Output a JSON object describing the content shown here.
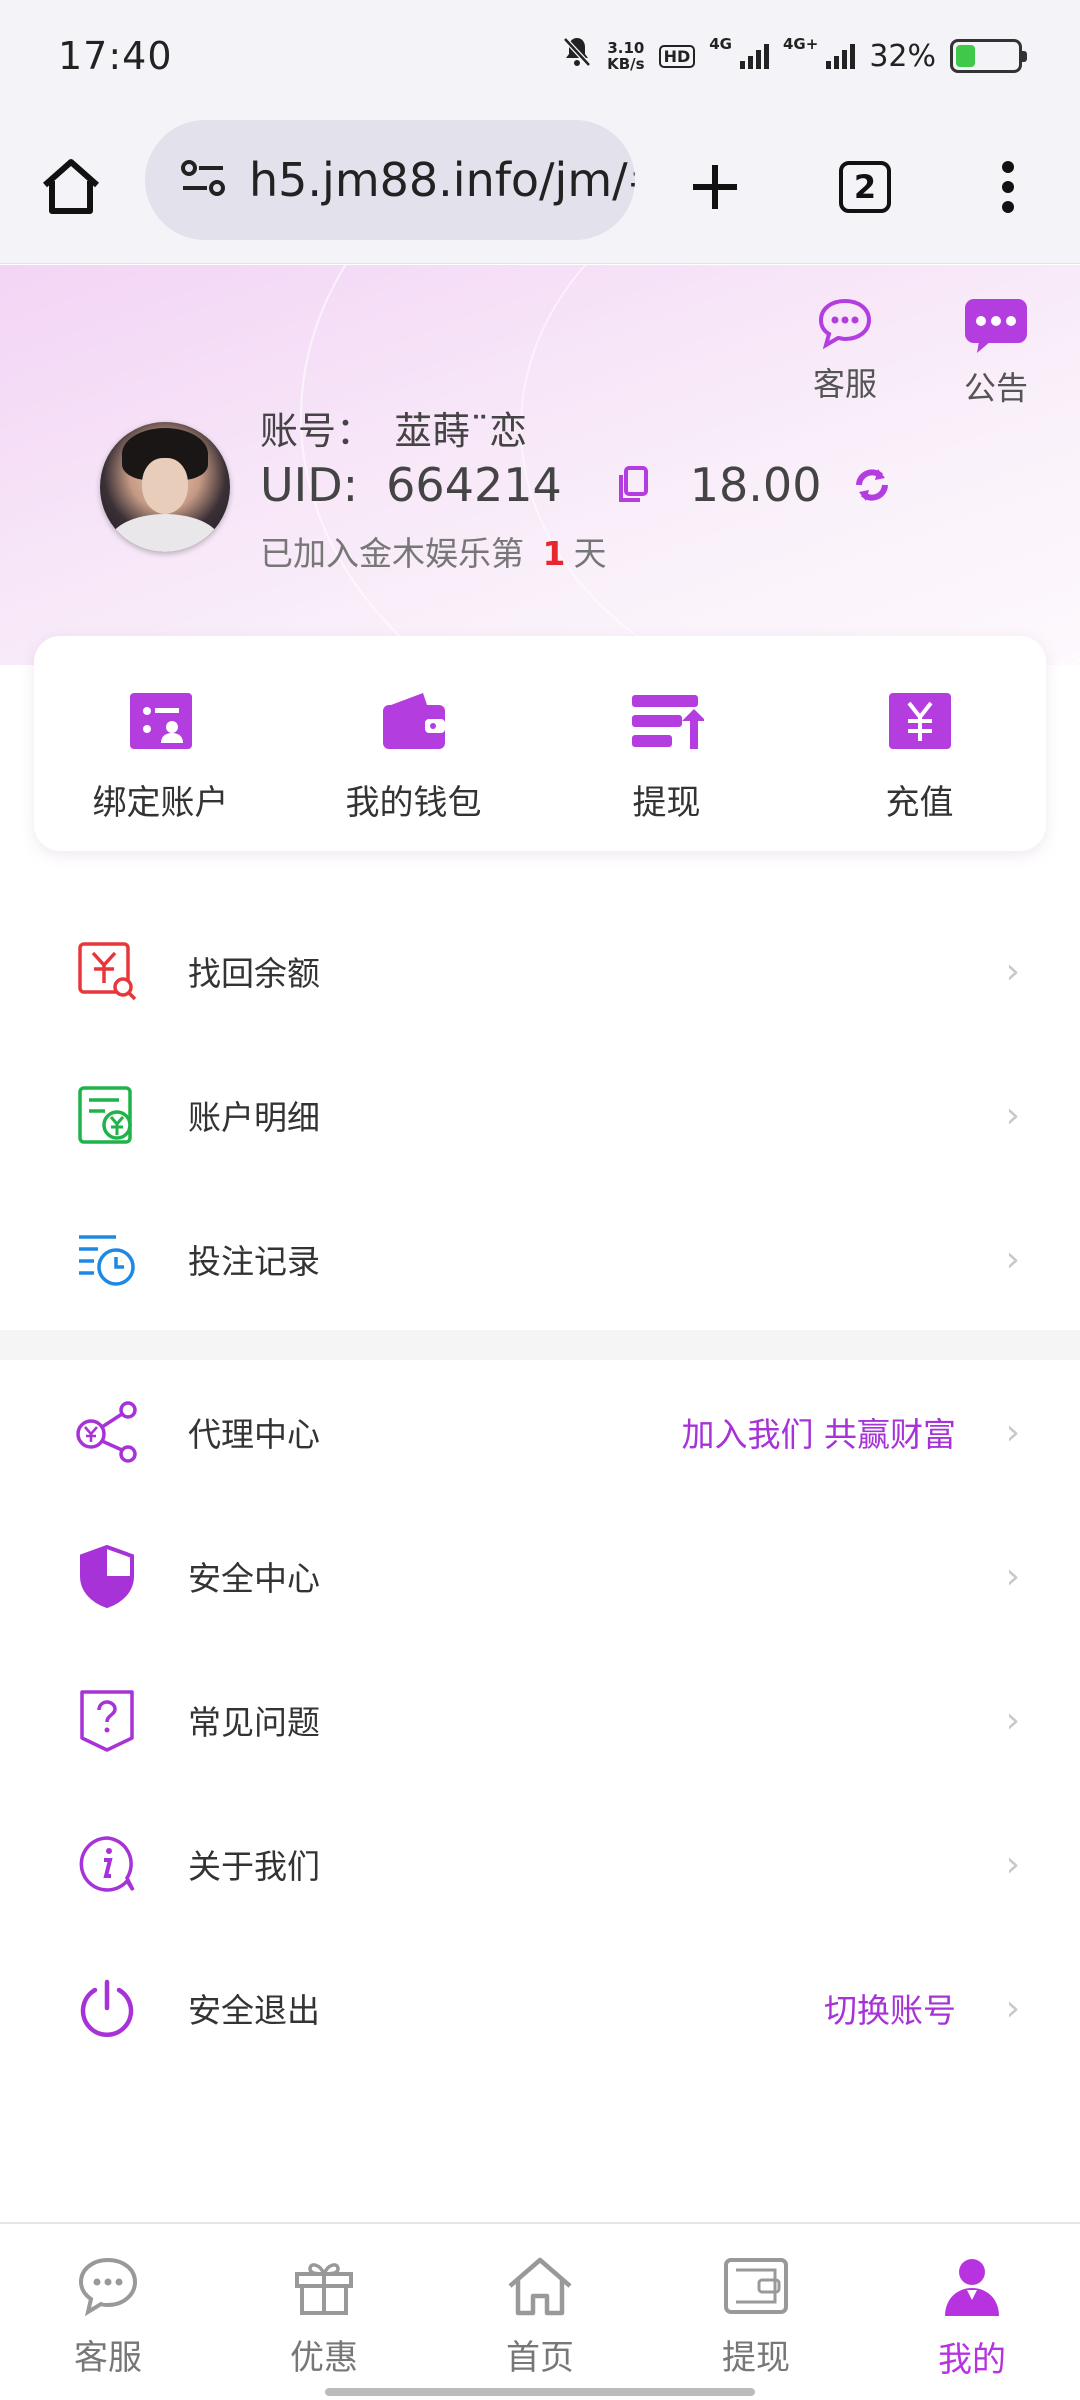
{
  "status_bar": {
    "time": "17:40",
    "speed_value": "3.10",
    "speed_unit": "KB/s",
    "hd_label": "HD",
    "net1": "4G",
    "net2": "4G+",
    "battery": "32%",
    "battery_level": 0.32
  },
  "browser": {
    "url": "h5.jm88.info/jm/#",
    "tab_count": "2"
  },
  "header": {
    "service_label": "客服",
    "notice_label": "公告",
    "account_prefix": "账号：",
    "account_name": "莁蒔¨恋",
    "uid_prefix": "UID:",
    "uid": "664214",
    "balance": "18.00",
    "join_prefix": "已加入金木娱乐第",
    "join_days": "1",
    "join_suffix": "天"
  },
  "quick_actions": [
    {
      "label": "绑定账户",
      "icon": "bind-account-icon"
    },
    {
      "label": "我的钱包",
      "icon": "wallet-icon"
    },
    {
      "label": "提现",
      "icon": "withdraw-icon"
    },
    {
      "label": "充值",
      "icon": "recharge-icon"
    }
  ],
  "menu": {
    "recover_balance": "找回余额",
    "account_details": "账户明细",
    "bet_records": "投注记录",
    "agent_center": "代理中心",
    "agent_extra": "加入我们 共赢财富",
    "security_center": "安全中心",
    "faq": "常见问题",
    "about_us": "关于我们",
    "logout": "安全退出",
    "logout_extra": "切换账号",
    "chevron": "›"
  },
  "bottom_nav": [
    {
      "label": "客服",
      "icon": "chat-icon",
      "active": false
    },
    {
      "label": "优惠",
      "icon": "gift-icon",
      "active": false
    },
    {
      "label": "首页",
      "icon": "home-icon",
      "active": false
    },
    {
      "label": "提现",
      "icon": "withdraw-wallet-icon",
      "active": false
    },
    {
      "label": "我的",
      "icon": "user-icon",
      "active": true
    }
  ],
  "colors": {
    "accent": "#a733d8",
    "active_nav": "#b733e0",
    "days_highlight": "#e8262d"
  }
}
